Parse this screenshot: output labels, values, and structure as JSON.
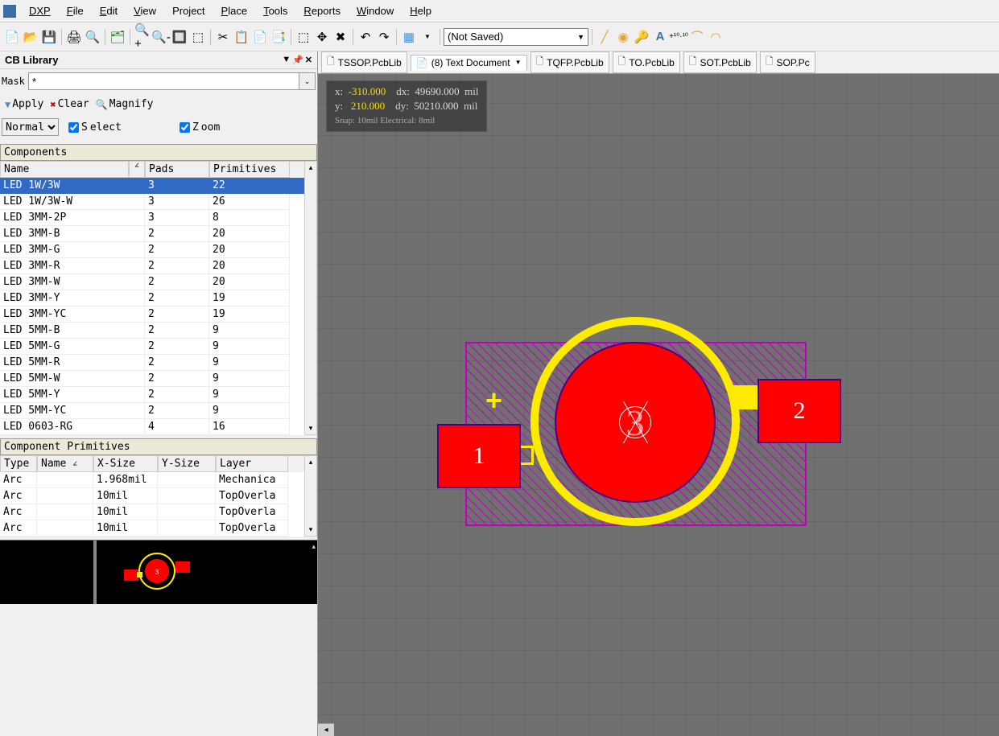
{
  "menubar": {
    "dxp": "DXP",
    "items": [
      "File",
      "Edit",
      "View",
      "Project",
      "Place",
      "Tools",
      "Reports",
      "Window",
      "Help"
    ]
  },
  "toolbar": {
    "combo": "(Not Saved)"
  },
  "panel": {
    "title": "CB Library",
    "mask_label": "Mask",
    "mask_value": "*",
    "apply": "Apply",
    "clear": "Clear",
    "magnify": "Magnify",
    "mode": "Normal",
    "select": "Select",
    "zoom": "Zoom",
    "components_header": "Components",
    "comp_columns": [
      "Name",
      "Pads",
      "Primitives"
    ],
    "components": [
      {
        "name": "LED 1W/3W",
        "pads": "3",
        "prims": "22",
        "sel": true
      },
      {
        "name": "LED 1W/3W-W",
        "pads": "3",
        "prims": "26"
      },
      {
        "name": "LED 3MM-2P",
        "pads": "3",
        "prims": "8"
      },
      {
        "name": "LED 3MM-B",
        "pads": "2",
        "prims": "20"
      },
      {
        "name": "LED 3MM-G",
        "pads": "2",
        "prims": "20"
      },
      {
        "name": "LED 3MM-R",
        "pads": "2",
        "prims": "20"
      },
      {
        "name": "LED 3MM-W",
        "pads": "2",
        "prims": "20"
      },
      {
        "name": "LED 3MM-Y",
        "pads": "2",
        "prims": "19"
      },
      {
        "name": "LED 3MM-YC",
        "pads": "2",
        "prims": "19"
      },
      {
        "name": "LED 5MM-B",
        "pads": "2",
        "prims": "9"
      },
      {
        "name": "LED 5MM-G",
        "pads": "2",
        "prims": "9"
      },
      {
        "name": "LED 5MM-R",
        "pads": "2",
        "prims": "9"
      },
      {
        "name": "LED 5MM-W",
        "pads": "2",
        "prims": "9"
      },
      {
        "name": "LED 5MM-Y",
        "pads": "2",
        "prims": "9"
      },
      {
        "name": "LED 5MM-YC",
        "pads": "2",
        "prims": "9"
      },
      {
        "name": "LED 0603-RG",
        "pads": "4",
        "prims": "16"
      }
    ],
    "primitives_header": "Component Primitives",
    "prim_columns": [
      "Type",
      "Name",
      "X-Size",
      "Y-Size",
      "Layer"
    ],
    "primitives": [
      {
        "type": "Arc",
        "name": "",
        "xsize": "1.968mil",
        "ysize": "",
        "layer": "Mechanica"
      },
      {
        "type": "Arc",
        "name": "",
        "xsize": "10mil",
        "ysize": "",
        "layer": "TopOverla"
      },
      {
        "type": "Arc",
        "name": "",
        "xsize": "10mil",
        "ysize": "",
        "layer": "TopOverla"
      },
      {
        "type": "Arc",
        "name": "",
        "xsize": "10mil",
        "ysize": "",
        "layer": "TopOverla"
      }
    ]
  },
  "tabs": [
    {
      "label": "TSSOP.PcbLib",
      "ico": "pcb"
    },
    {
      "label": "(8) Text Document",
      "ico": "txt",
      "drop": true,
      "active": true
    },
    {
      "label": "TQFP.PcbLib",
      "ico": "pcb"
    },
    {
      "label": "TO.PcbLib",
      "ico": "pcb"
    },
    {
      "label": "SOT.PcbLib",
      "ico": "pcb"
    },
    {
      "label": "SOP.Pc",
      "ico": "pcb"
    }
  ],
  "coords": {
    "x_label": "x:",
    "x_val": "-310.000",
    "dx_label": "dx:",
    "dx_val": "49690.000",
    "unit": "mil",
    "y_label": "y:",
    "y_val": "210.000",
    "dy_label": "dy:",
    "dy_val": "50210.000",
    "snap": "Snap: 10mil Electrical: 8mil"
  },
  "pads": {
    "p1": "1",
    "p2": "2",
    "p3": "3"
  }
}
